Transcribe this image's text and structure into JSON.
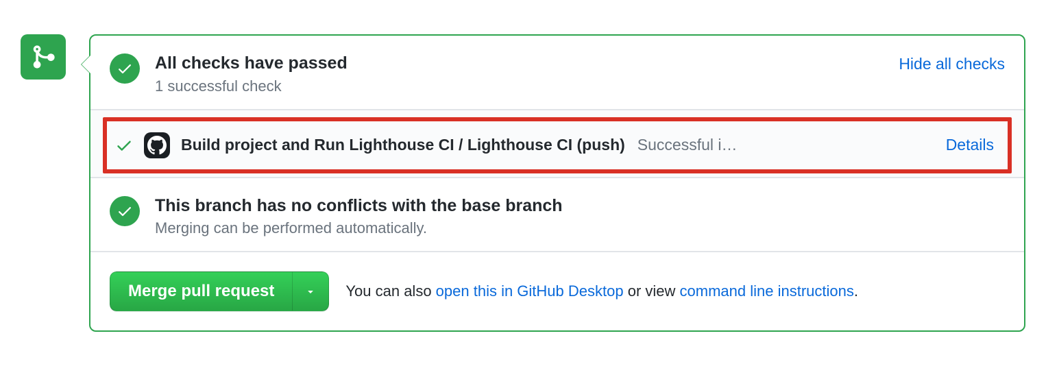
{
  "checks": {
    "title": "All checks have passed",
    "subtitle": "1 successful check",
    "toggle_label": "Hide all checks",
    "items": [
      {
        "name": "Build project and Run Lighthouse CI / Lighthouse CI (push)",
        "status_text": "Successful i…",
        "details_label": "Details"
      }
    ]
  },
  "conflicts": {
    "title": "This branch has no conflicts with the base branch",
    "subtitle": "Merging can be performed automatically."
  },
  "merge": {
    "button_label": "Merge pull request",
    "help_prefix": "You can also ",
    "desktop_link": "open this in GitHub Desktop",
    "help_middle": " or view ",
    "cli_link": "command line instructions",
    "help_suffix": "."
  }
}
